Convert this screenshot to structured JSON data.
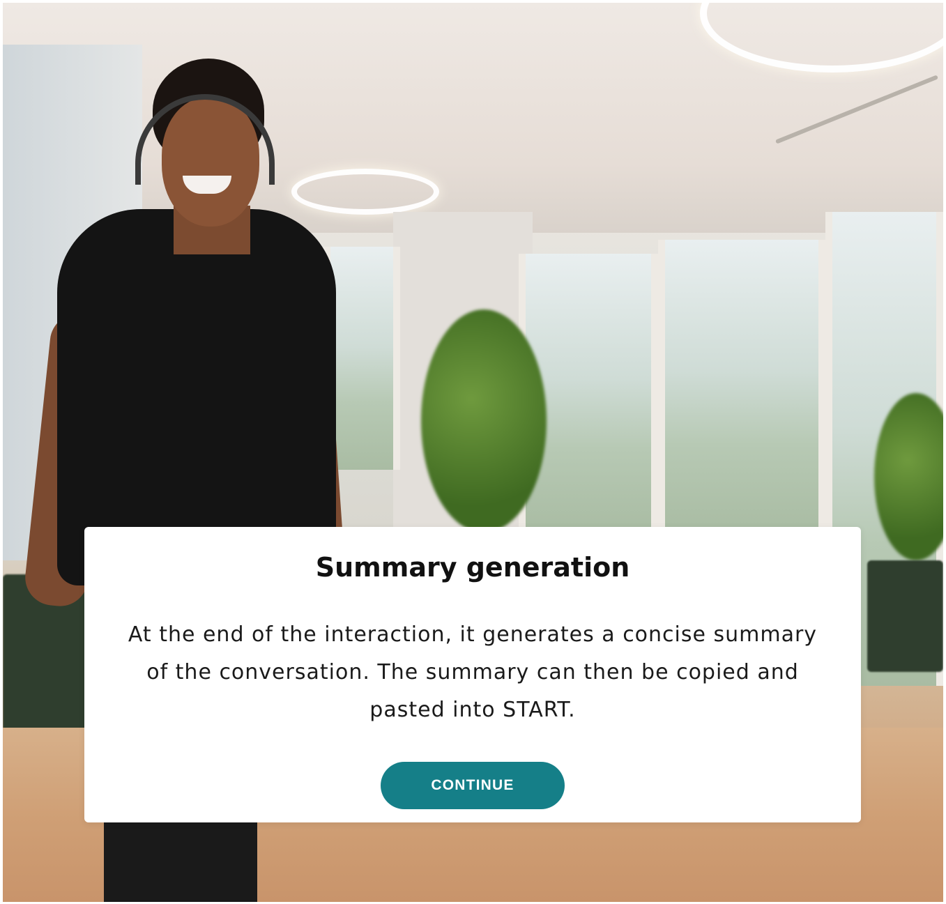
{
  "modal": {
    "title": "Summary generation",
    "body": "At the end of the interaction, it generates a concise summary of the conversation. The summary can then be copied and pasted into START.",
    "continue_label": "CONTINUE"
  },
  "colors": {
    "button": "#157f88",
    "modal_bg": "#ffffff"
  }
}
